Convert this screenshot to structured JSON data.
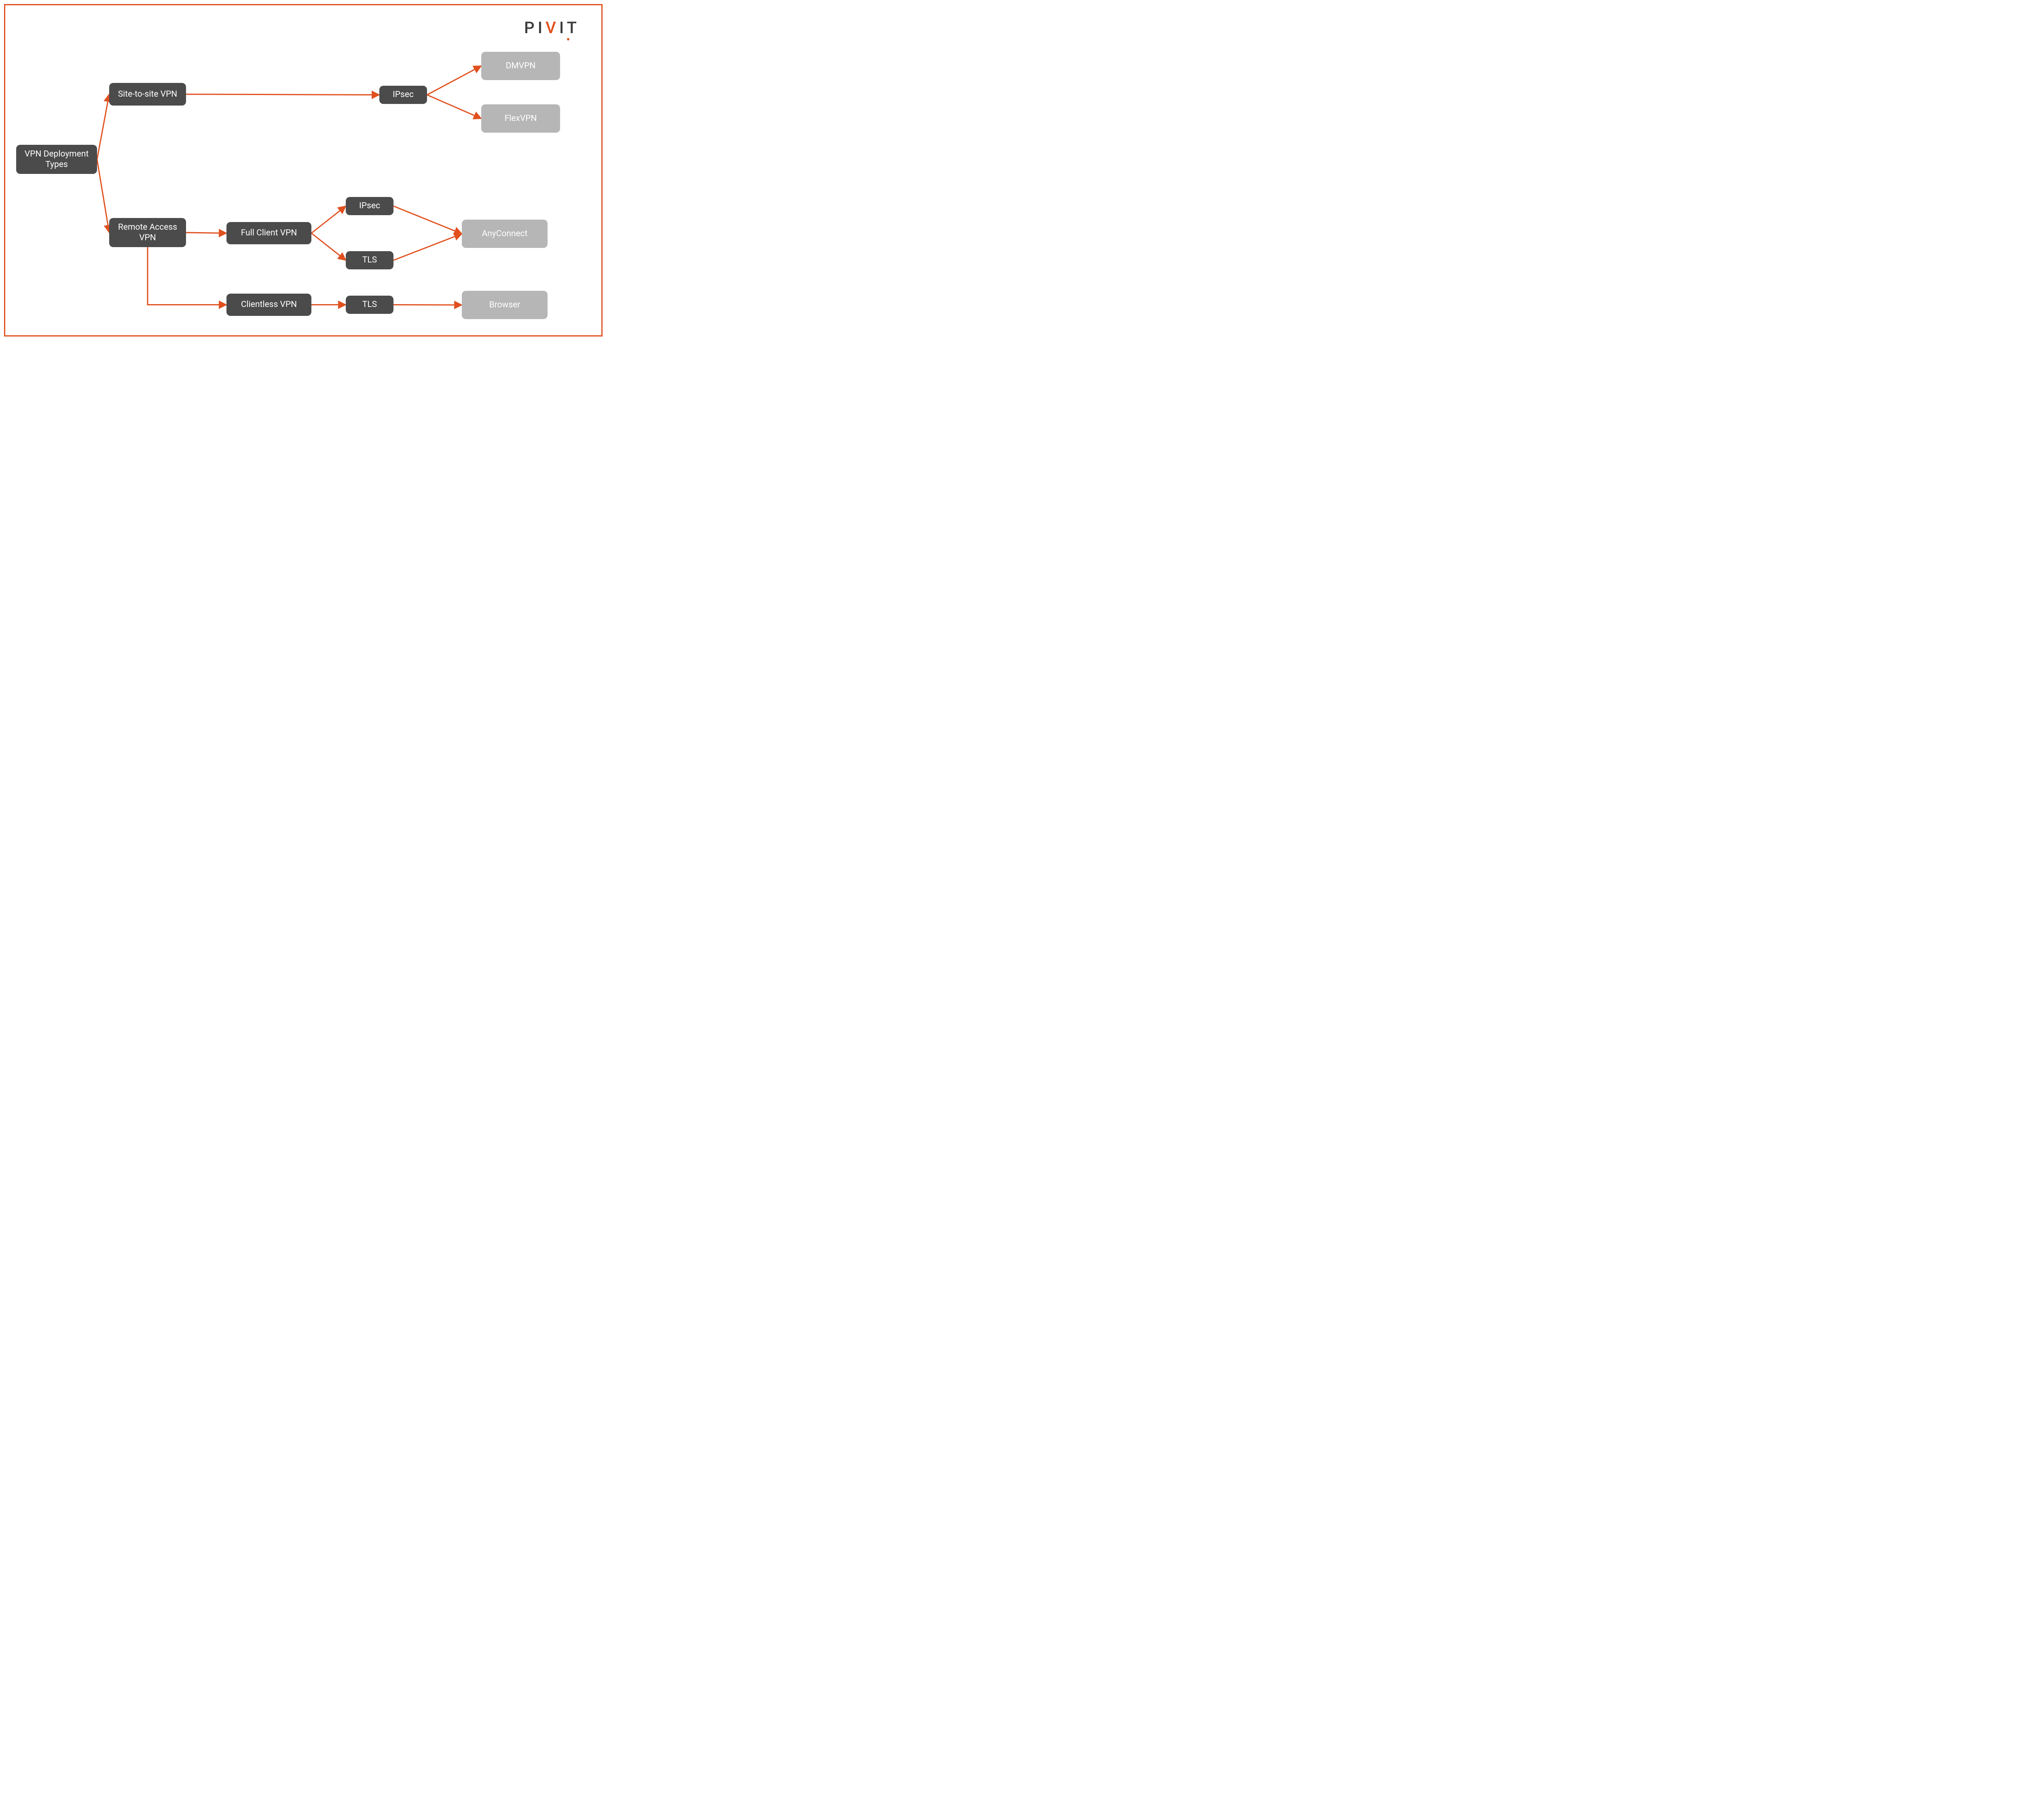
{
  "logo": {
    "part1": "PI",
    "accent": "V",
    "part2": "IT"
  },
  "colors": {
    "accent": "#E1501E",
    "darkNode": "#4b4b4b",
    "lightNode": "#b6b6b6"
  },
  "nodes": {
    "root": "VPN Deployment Types",
    "site": "Site-to-site VPN",
    "remote": "Remote Access VPN",
    "ipsec1": "IPsec",
    "dmvpn": "DMVPN",
    "flexvpn": "FlexVPN",
    "fullclient": "Full Client VPN",
    "clientless": "Clientless VPN",
    "ipsec2": "IPsec",
    "tls1": "TLS",
    "anyconnect": "AnyConnect",
    "tls2": "TLS",
    "browser": "Browser"
  },
  "edges": [
    {
      "from": "root",
      "to": "site"
    },
    {
      "from": "root",
      "to": "remote"
    },
    {
      "from": "site",
      "to": "ipsec1"
    },
    {
      "from": "ipsec1",
      "to": "dmvpn"
    },
    {
      "from": "ipsec1",
      "to": "flexvpn"
    },
    {
      "from": "remote",
      "to": "fullclient"
    },
    {
      "from": "remote",
      "to": "clientless",
      "elbow": true
    },
    {
      "from": "fullclient",
      "to": "ipsec2"
    },
    {
      "from": "fullclient",
      "to": "tls1"
    },
    {
      "from": "ipsec2",
      "to": "anyconnect"
    },
    {
      "from": "tls1",
      "to": "anyconnect"
    },
    {
      "from": "clientless",
      "to": "tls2"
    },
    {
      "from": "tls2",
      "to": "browser"
    }
  ]
}
